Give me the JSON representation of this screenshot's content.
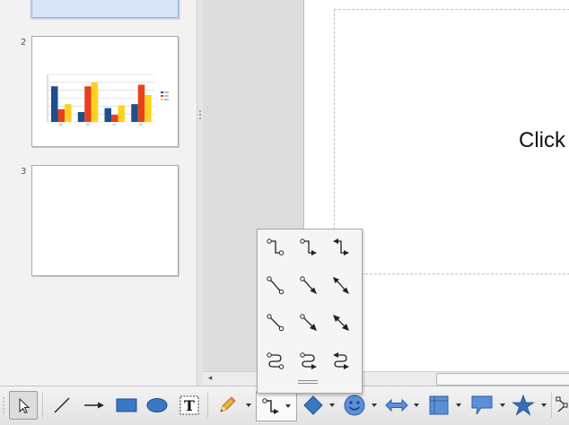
{
  "slides": [
    {
      "number": "",
      "selected": true
    },
    {
      "number": "2",
      "content": "chart"
    },
    {
      "number": "3",
      "content": "blank"
    }
  ],
  "thumbnail_chart": {
    "type": "bar",
    "categories": [
      "",
      "",
      "",
      ""
    ],
    "series": [
      {
        "color": "#1f4e8c",
        "values": [
          9,
          2.5,
          3.5,
          4.5
        ]
      },
      {
        "color": "#e8401c",
        "values": [
          3.2,
          9,
          1.8,
          9.4
        ]
      },
      {
        "color": "#ffd21f",
        "values": [
          4.5,
          10,
          4.2,
          6.8
        ]
      }
    ],
    "ylim": [
      0,
      12
    ]
  },
  "editor": {
    "placeholder_text": "Click"
  },
  "colors": {
    "shape_fill": "#3a78c3",
    "star_fill": "#3a6fb8",
    "smiley_fill": "#5c8fd6",
    "popup_bg": "#f5f5f5",
    "toolbar_bg": "#e8e8e8"
  },
  "toolbar": {
    "tools": [
      {
        "name": "select",
        "icon": "arrow-cursor-icon",
        "active": true
      },
      {
        "name": "line",
        "icon": "line-icon"
      },
      {
        "name": "line-ends-with-arrow",
        "icon": "arrow-line-icon"
      },
      {
        "name": "rectangle",
        "icon": "rectangle-icon"
      },
      {
        "name": "ellipse",
        "icon": "ellipse-icon"
      },
      {
        "name": "text",
        "icon": "text-box-icon"
      },
      {
        "name": "curve",
        "icon": "pencil-icon"
      },
      {
        "name": "connector",
        "icon": "connector-icon",
        "open": true
      },
      {
        "name": "basic-shapes",
        "icon": "diamond-icon"
      },
      {
        "name": "symbol-shapes",
        "icon": "smiley-icon"
      },
      {
        "name": "block-arrows",
        "icon": "double-arrow-icon"
      },
      {
        "name": "flowchart",
        "icon": "flowchart-icon"
      },
      {
        "name": "callouts",
        "icon": "callout-icon"
      },
      {
        "name": "stars",
        "icon": "star-icon"
      },
      {
        "name": "points",
        "icon": "points-icon"
      }
    ]
  },
  "connector_popup": {
    "rows": [
      {
        "kind": "standard",
        "items": [
          "connector-ends-circle-icon",
          "connector-ends-arrow-icon",
          "connector-arrows-both-icon"
        ]
      },
      {
        "kind": "line",
        "items": [
          "line-connector-circle-icon",
          "line-connector-arrow-icon",
          "line-connector-arrows-both-icon"
        ]
      },
      {
        "kind": "straight",
        "items": [
          "straight-connector-circle-icon",
          "straight-connector-arrow-icon",
          "straight-connector-arrows-both-icon"
        ]
      },
      {
        "kind": "curved",
        "items": [
          "curved-connector-circle-icon",
          "curved-connector-arrow-icon",
          "curved-connector-arrows-both-icon"
        ]
      }
    ]
  }
}
